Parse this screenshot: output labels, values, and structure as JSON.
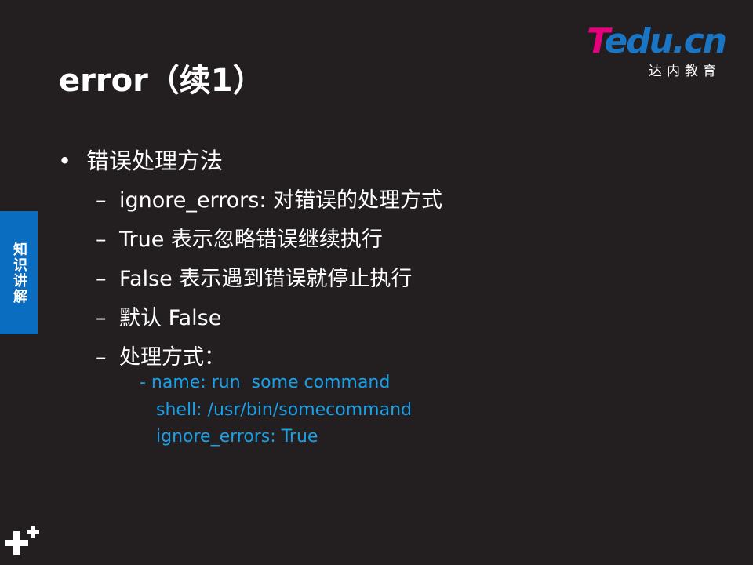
{
  "slide": {
    "title": "error（续1）"
  },
  "logo": {
    "brand_t": "T",
    "brand_rest": "edu.cn",
    "sub": "达内教育",
    "colors": {
      "t": "#e6007e",
      "rest": "#1a75c4"
    }
  },
  "side_tab": {
    "label": "知识讲解",
    "color": "#0b6dbf"
  },
  "content": {
    "bullet": "•",
    "heading": "错误处理方法",
    "dash": "–",
    "items": [
      "ignore_errors: 对错误的处理方式",
      "True 表示忽略错误继续执行",
      "False 表示遇到错误就停止执行",
      "默认 False",
      "处理方式："
    ],
    "code": [
      "- name: run  some command",
      "shell: /usr/bin/somecommand",
      "ignore_errors: True"
    ]
  },
  "colors": {
    "background": "#231f20",
    "code": "#1aa0e8"
  },
  "icons": {
    "corner": "plus-icon"
  }
}
